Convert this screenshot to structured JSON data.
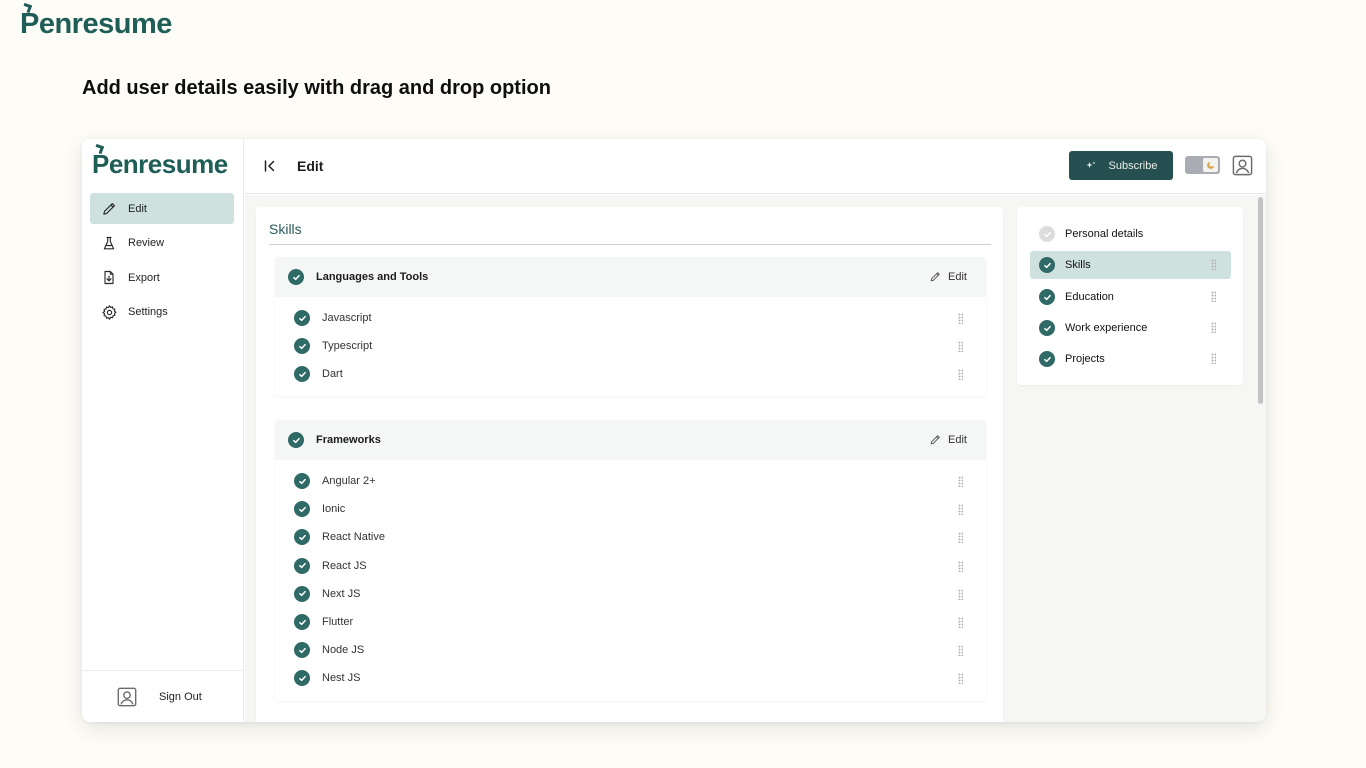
{
  "brand": {
    "name_first": "P",
    "name_rest": "enresume",
    "color": "#1f5d57"
  },
  "headline": "Add user details easily with drag and drop option",
  "sidebar": {
    "brand_first": "P",
    "brand_rest": "enresume",
    "items": [
      {
        "label": "Edit",
        "icon": "pencil-icon",
        "active": true
      },
      {
        "label": "Review",
        "icon": "flask-icon",
        "active": false
      },
      {
        "label": "Export",
        "icon": "download-file-icon",
        "active": false
      },
      {
        "label": "Settings",
        "icon": "gear-icon",
        "active": false
      }
    ],
    "signout_label": "Sign Out"
  },
  "topbar": {
    "title": "Edit",
    "subscribe_label": "Subscribe",
    "accent": "#264f51"
  },
  "skills": {
    "title": "Skills",
    "groups": [
      {
        "title": "Languages and Tools",
        "edit_label": "Edit",
        "items": [
          "Javascript",
          "Typescript",
          "Dart"
        ]
      },
      {
        "title": "Frameworks",
        "edit_label": "Edit",
        "items": [
          "Angular 2+",
          "Ionic",
          "React Native",
          "React JS",
          "Next JS",
          "Flutter",
          "Node JS",
          "Nest JS"
        ]
      }
    ]
  },
  "sections": {
    "items": [
      {
        "label": "Personal details",
        "checked": false,
        "active": false,
        "draggable": false
      },
      {
        "label": "Skills",
        "checked": true,
        "active": true,
        "draggable": true
      },
      {
        "label": "Education",
        "checked": true,
        "active": false,
        "draggable": true
      },
      {
        "label": "Work experience",
        "checked": true,
        "active": false,
        "draggable": true
      },
      {
        "label": "Projects",
        "checked": true,
        "active": false,
        "draggable": true
      }
    ]
  },
  "colors": {
    "check": "#2f6a67",
    "active_bg": "#cfe1df",
    "background": "#fdfcf7"
  }
}
